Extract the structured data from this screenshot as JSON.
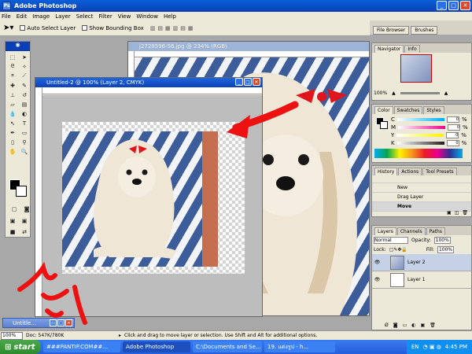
{
  "app": {
    "title": "Adobe Photoshop",
    "logo": "Ps"
  },
  "menu": [
    "File",
    "Edit",
    "Image",
    "Layer",
    "Select",
    "Filter",
    "View",
    "Window",
    "Help"
  ],
  "options": {
    "auto_select": "Auto Select Layer",
    "bounding_box": "Show Bounding Box"
  },
  "well_tabs": [
    "File Browser",
    "Brushes"
  ],
  "doc_back": {
    "title": "j2728596-56.jpg @ 234% (RGB)"
  },
  "doc_front": {
    "title": "Untitled-2 @ 100% (Layer 2, CMYK)"
  },
  "minimized": {
    "title": "Untitle..."
  },
  "navigator": {
    "tabs": [
      "Navigator",
      "Info"
    ],
    "zoom": "100%"
  },
  "color_panel": {
    "tabs": [
      "Color",
      "Swatches",
      "Styles"
    ],
    "channels": [
      {
        "label": "C",
        "value": "0",
        "unit": "%",
        "color": "#00aeef"
      },
      {
        "label": "M",
        "value": "0",
        "unit": "%",
        "color": "#ec008c"
      },
      {
        "label": "Y",
        "value": "0",
        "unit": "%",
        "color": "#fff200"
      },
      {
        "label": "K",
        "value": "0",
        "unit": "%",
        "color": "#231f20"
      }
    ]
  },
  "history": {
    "tabs": [
      "History",
      "Actions",
      "Tool Presets"
    ],
    "items": [
      "New",
      "Drag Layer",
      "Move"
    ]
  },
  "layers": {
    "tabs": [
      "Layers",
      "Channels",
      "Paths"
    ],
    "blend_mode": "Normal",
    "opacity_label": "Opacity:",
    "opacity": "100%",
    "lock_label": "Lock:",
    "fill_label": "Fill:",
    "fill": "100%",
    "rows": [
      {
        "name": "Layer 2",
        "selected": true
      },
      {
        "name": "Layer 1",
        "selected": false
      }
    ]
  },
  "status": {
    "zoom": "100%",
    "doc": "Doc: 547K/780K",
    "hint": "Click and drag to move layer or selection. Use Shift and Alt for additional options."
  },
  "taskbar": {
    "start": "start",
    "tasks": [
      "###PANTIP.COM##...",
      "Adobe Photoshop",
      "C:\\Documents and Se...",
      "19. แต่งรูป - h..."
    ],
    "lang": "EN",
    "time": "4:45 PM"
  }
}
